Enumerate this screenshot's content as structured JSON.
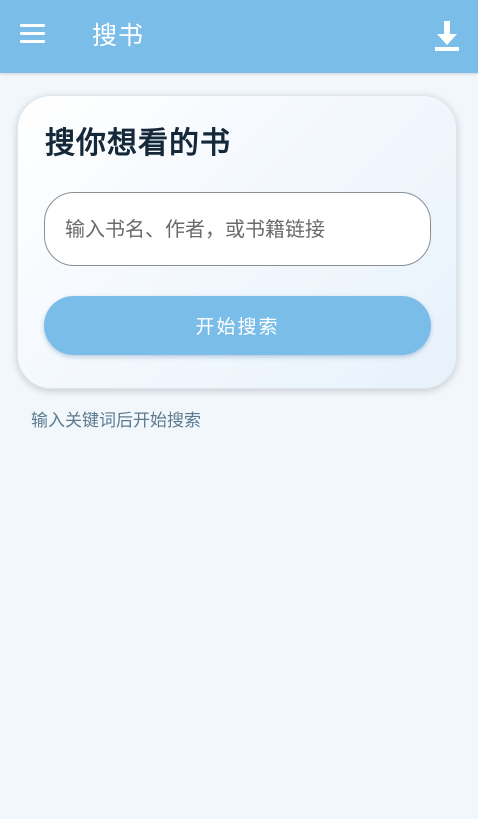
{
  "appbar": {
    "title": "搜书",
    "menu_icon": "hamburger-menu-icon",
    "download_icon": "download-icon",
    "color": "#7bbde9"
  },
  "search_card": {
    "title": "搜你想看的书",
    "input": {
      "value": "",
      "placeholder": "输入书名、作者，或书籍链接"
    },
    "button_label": "开始搜索"
  },
  "hint": "输入关键词后开始搜索"
}
